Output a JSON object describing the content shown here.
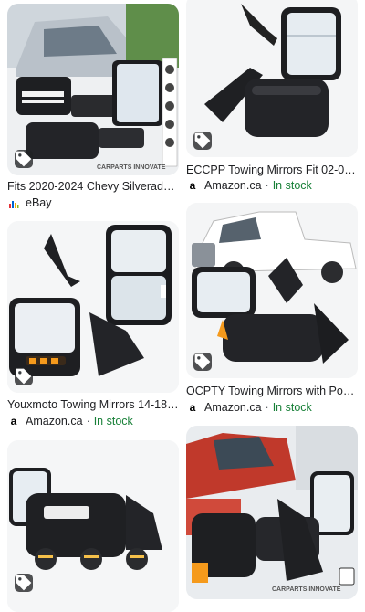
{
  "colors": {
    "in_stock": "#188038",
    "tag_bg": "#3c4043",
    "ebay_mark": [
      "#e53238",
      "#0064d2",
      "#f5af02",
      "#86b817"
    ]
  },
  "results": [
    {
      "title": "Fits 2020-2024 Chevy Silverado...",
      "source": "eBay",
      "source_icon": "ebay-icon",
      "stock": "",
      "watermark": "CARPARTS INNOVATE"
    },
    {
      "title": "ECCPP Towing Mirrors Fit 02-08...",
      "source": "Amazon.ca",
      "source_icon": "amazon-icon",
      "stock": "In stock"
    },
    {
      "title": "Youxmoto Towing Mirrors 14-18 f...",
      "source": "Amazon.ca",
      "source_icon": "amazon-icon",
      "stock": "In stock"
    },
    {
      "title": "OCPTY Towing Mirrors with Pow...",
      "source": "Amazon.ca",
      "source_icon": "amazon-icon",
      "stock": "In stock"
    },
    {
      "title": "",
      "source": "",
      "source_icon": "",
      "stock": ""
    },
    {
      "title": "",
      "source": "",
      "source_icon": "",
      "stock": "",
      "watermark": "CARPARTS INNOVATE"
    }
  ]
}
